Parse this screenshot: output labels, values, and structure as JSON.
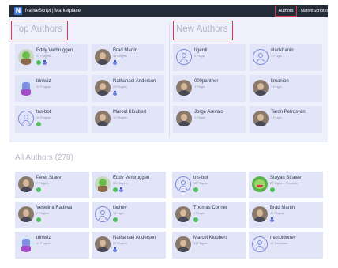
{
  "navbar": {
    "logo_letter": "N",
    "brand": "NativeScript | Marketplace",
    "links": [
      {
        "label": "Authors",
        "active": true
      },
      {
        "label": "NativeScript.org",
        "active": false
      }
    ]
  },
  "top_authors": {
    "title": "Top Authors",
    "cards": [
      {
        "name": "Eddy Verbruggen",
        "sub": "22 Plugins",
        "avatar": "yoda",
        "badges": [
          "green-dot-icon",
          "medal-icon"
        ]
      },
      {
        "name": "Brad Martin",
        "sub": "31 Plugins",
        "avatar": "photo",
        "badges": [
          "medal-icon"
        ]
      },
      {
        "name": "triniwiz",
        "sub": "24 Plugins",
        "avatar": "bot",
        "badges": []
      },
      {
        "name": "Nathanael Anderson",
        "sub": "23 Plugins",
        "avatar": "photo",
        "badges": [
          "medal-icon"
        ]
      },
      {
        "name": "tns-bot",
        "sub": "15 Plugins",
        "avatar": "placeholder",
        "badges": [
          "green-dot-icon"
        ]
      },
      {
        "name": "Marcel Kloubert",
        "sub": "12 Plugins",
        "avatar": "photo",
        "badges": []
      }
    ]
  },
  "new_authors": {
    "title": "New Authors",
    "cards": [
      {
        "name": "tigerdi",
        "sub": "1 Plugin",
        "avatar": "placeholder",
        "badges": []
      },
      {
        "name": "vladkhanin",
        "sub": "1 Plugin",
        "avatar": "placeholder",
        "badges": []
      },
      {
        "name": "000panther",
        "sub": "1 Plugin",
        "avatar": "photo",
        "badges": []
      },
      {
        "name": "kmanion",
        "sub": "1 Plugin",
        "avatar": "photo",
        "badges": []
      },
      {
        "name": "Jorge Arevalo",
        "sub": "1 Plugin",
        "avatar": "photo",
        "badges": []
      },
      {
        "name": "Taron Petrosyan",
        "sub": "1 Plugin",
        "avatar": "photo",
        "badges": []
      }
    ]
  },
  "all_authors": {
    "title": "All Authors (278)",
    "cards": [
      {
        "name": "Peter Staev",
        "sub": "7 Plugins",
        "avatar": "photo",
        "badges": [
          "green-dot-icon"
        ]
      },
      {
        "name": "Eddy Verbruggen",
        "sub": "41 Plugins",
        "avatar": "yoda",
        "badges": [
          "green-dot-icon",
          "medal-icon"
        ]
      },
      {
        "name": "tns-bot",
        "sub": "15 Plugins",
        "avatar": "placeholder",
        "badges": [
          "green-dot-icon"
        ]
      },
      {
        "name": "Stoyan Stratev",
        "sub": "2 Plugins 1 Template",
        "avatar": "frog",
        "badges": [
          "green-dot-icon"
        ]
      },
      {
        "name": "Veselina Radeva",
        "sub": "2 Plugins",
        "avatar": "photo",
        "badges": [
          "green-dot-icon"
        ]
      },
      {
        "name": "tachev",
        "sub": "1 Plugin",
        "avatar": "placeholder",
        "badges": [
          "green-dot-icon"
        ]
      },
      {
        "name": "Thomas Conner",
        "sub": "1 Plugin",
        "avatar": "photo",
        "badges": [
          "green-dot-icon"
        ]
      },
      {
        "name": "Brad Martin",
        "sub": "31 Plugins",
        "avatar": "photo",
        "badges": [
          "medal-icon"
        ]
      },
      {
        "name": "triniwiz",
        "sub": "24 Plugins",
        "avatar": "bot",
        "badges": []
      },
      {
        "name": "Nathanael Anderson",
        "sub": "23 Plugins",
        "avatar": "photo",
        "badges": [
          "medal-icon"
        ]
      },
      {
        "name": "Marcel Kloubert",
        "sub": "15 Plugins",
        "avatar": "photo",
        "badges": []
      },
      {
        "name": "manoldonev",
        "sub": "14 Templates",
        "avatar": "placeholder",
        "badges": []
      }
    ]
  },
  "colors": {
    "navbar_bg": "#242c3a",
    "panel_bg": "#eef0fb",
    "card_bg": "#e2e5f7",
    "highlight": "#d83a4a",
    "badge_green": "#4cc25a",
    "badge_blue": "#3f58c9"
  }
}
